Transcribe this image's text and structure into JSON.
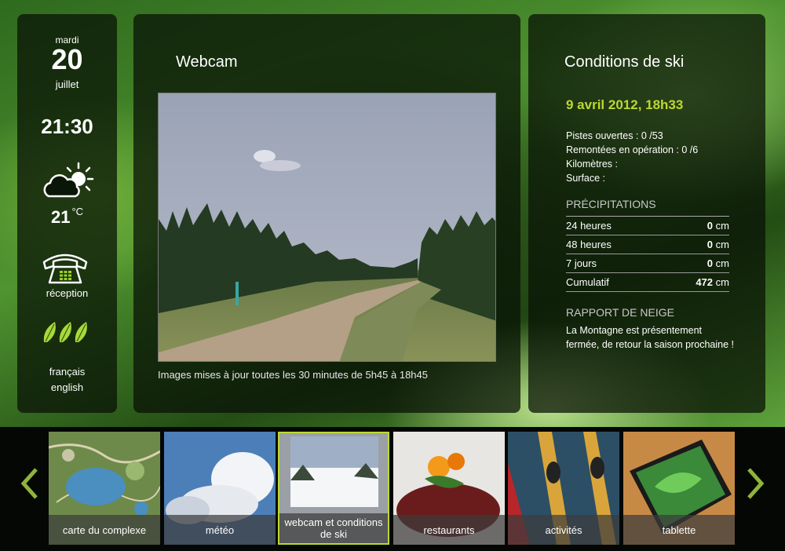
{
  "sidebar": {
    "day_name": "mardi",
    "day_number": "20",
    "month": "juillet",
    "time": "21:30",
    "temperature": "21",
    "temperature_unit": "°C",
    "reception_label": "réception",
    "lang_fr": "français",
    "lang_en": "english",
    "icons": [
      "weather-partly-cloudy-icon",
      "telephone-icon",
      "leaves-icon"
    ]
  },
  "webcam": {
    "title": "Webcam",
    "caption": "Images mises à jour toutes les 30 minutes de 5h45 à 18h45"
  },
  "ski": {
    "title": "Conditions de ski",
    "date": "9 avril 2012, 18h33",
    "stats": [
      "Pistes ouvertes : 0 /53",
      "Remontées en opération : 0 /6",
      "Kilomètres :",
      "Surface :"
    ],
    "precip_heading": "PRÉCIPITATIONS",
    "precip_rows": [
      {
        "label": "24 heures",
        "value": "0",
        "unit": "cm"
      },
      {
        "label": "48 heures",
        "value": "0",
        "unit": "cm"
      },
      {
        "label": "7 jours",
        "value": "0",
        "unit": "cm"
      },
      {
        "label": "Cumulatif",
        "value": "472",
        "unit": "cm"
      }
    ],
    "snow_heading": "RAPPORT DE NEIGE",
    "snow_text": "La Montagne est présentement fermée, de retour la saison prochaine !",
    "accent_color": "#bcd832"
  },
  "nav": {
    "items": [
      {
        "label": "carte du complexe"
      },
      {
        "label": "météo"
      },
      {
        "label": "webcam et conditions de ski",
        "active": true
      },
      {
        "label": "restaurants"
      },
      {
        "label": "activités"
      },
      {
        "label": "tablette"
      }
    ],
    "prev_icon": "chevron-left-icon",
    "next_icon": "chevron-right-icon"
  }
}
